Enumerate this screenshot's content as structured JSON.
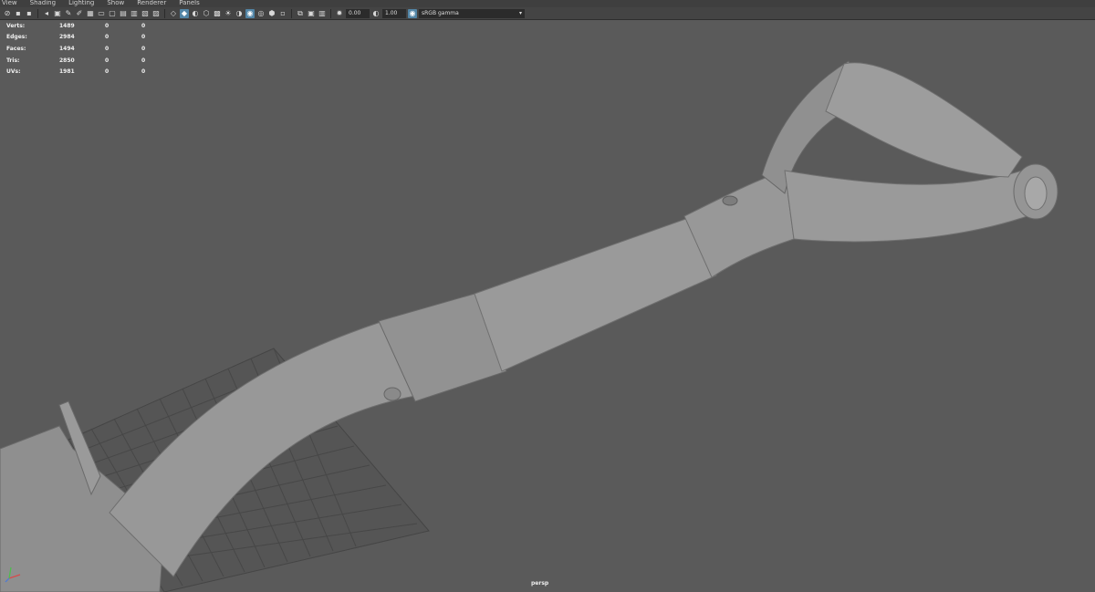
{
  "menu": [
    "View",
    "Shading",
    "Lighting",
    "Show",
    "Renderer",
    "Panels"
  ],
  "toolbar": {
    "near_clip": "0.00",
    "gamma": "1.00",
    "color_space": "sRGB gamma"
  },
  "hud": {
    "rows": [
      {
        "label": "Verts:",
        "v1": "1489",
        "v2": "0",
        "v3": "0"
      },
      {
        "label": "Edges:",
        "v1": "2984",
        "v2": "0",
        "v3": "0"
      },
      {
        "label": "Faces:",
        "v1": "1494",
        "v2": "0",
        "v3": "0"
      },
      {
        "label": "Tris:",
        "v1": "2850",
        "v2": "0",
        "v3": "0"
      },
      {
        "label": "UVs:",
        "v1": "1981",
        "v2": "0",
        "v3": "0"
      }
    ]
  },
  "camera_label": "persp",
  "colors": {
    "viewport_bg": "#5a5a5a",
    "model": "#9b9b9b",
    "grid": "#4a4a4a",
    "accent": "#5285a6"
  }
}
